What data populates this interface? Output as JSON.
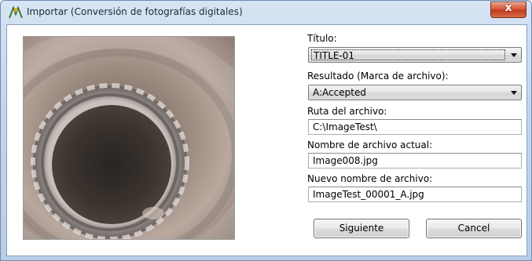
{
  "window": {
    "title": "Importar (Conversión de fotografías digitales)",
    "close_label": "x"
  },
  "form": {
    "titulo_label": "Título:",
    "titulo_value": "TITLE-01",
    "resultado_label": "Resultado (Marca de archivo):",
    "resultado_value": "A:Accepted",
    "ruta_label": "Ruta del archivo:",
    "ruta_value": "C:\\ImageTest\\",
    "actual_label": "Nombre de archivo actual:",
    "actual_value": "Image008.jpg",
    "nuevo_label": "Nuevo nombre de archivo:",
    "nuevo_value": "ImageTest_00001_A.jpg"
  },
  "buttons": {
    "next_label": "Siguiente",
    "cancel_label": "Cancel"
  },
  "colors": {
    "titlebar": "#c4d6ec",
    "close": "#c23b1e"
  }
}
